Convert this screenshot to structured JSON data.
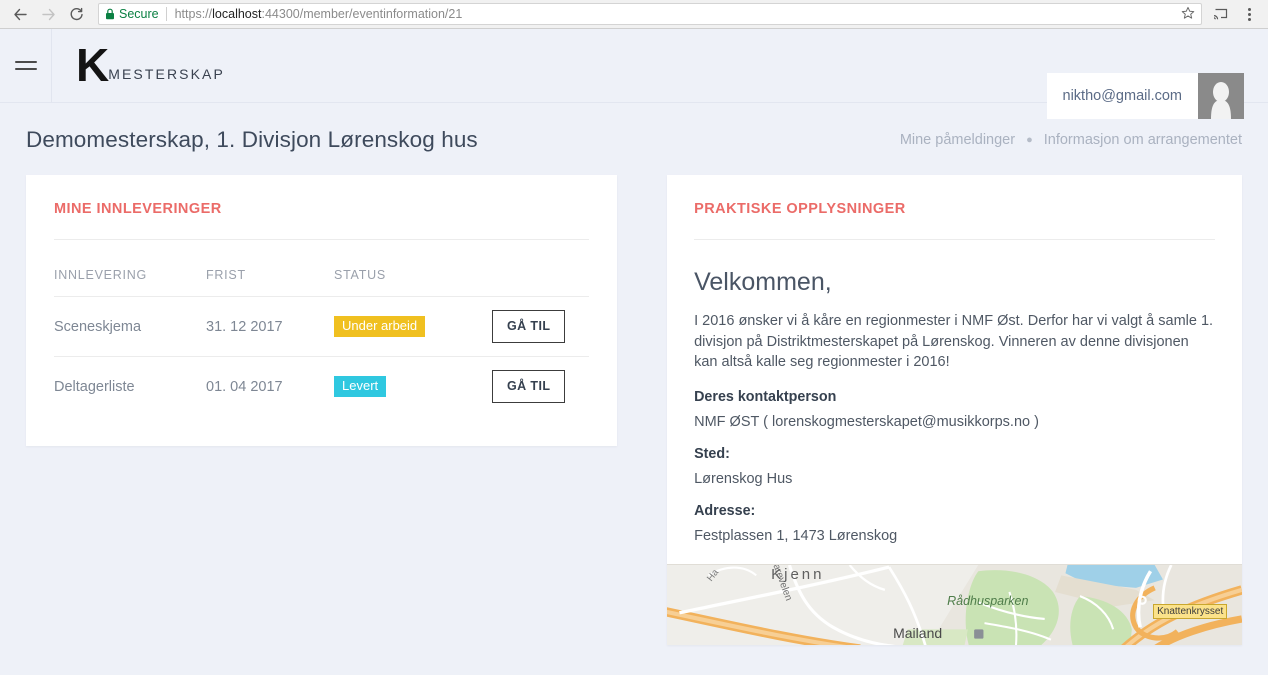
{
  "browser": {
    "back_icon": "back-arrow-icon",
    "forward_icon": "forward-arrow-icon",
    "reload_icon": "reload-icon",
    "secure_label": "Secure",
    "url_scheme": "https://",
    "url_host": "localhost",
    "url_path": ":44300/member/eventinformation/21",
    "url_full": "https://localhost:44300/member/eventinformation/21",
    "star_icon": "bookmark-star-icon",
    "cast_icon": "cast-icon",
    "menu_icon": "kebab-menu-icon"
  },
  "header": {
    "menu_icon": "hamburger-menu-icon",
    "logo_mark": "K",
    "logo_word": "MESTERSKAP",
    "user_email": "niktho@gmail.com",
    "avatar_icon": "user-avatar-icon"
  },
  "page": {
    "title": "Demomesterskap, 1. Divisjon Lørenskog hus",
    "breadcrumb": [
      {
        "label": "Mine påmeldinger"
      },
      {
        "label": "Informasjon om arrangementet"
      }
    ],
    "breadcrumb_separator": "●"
  },
  "submissions_card": {
    "heading": "MINE INNLEVERINGER",
    "columns": [
      "INNLEVERING",
      "FRIST",
      "STATUS",
      ""
    ],
    "rows": [
      {
        "name": "Sceneskjema",
        "deadline": "31. 12 2017",
        "status": "Under arbeid",
        "status_kind": "warn",
        "status_color": "#f0c020",
        "action": "GÅ TIL"
      },
      {
        "name": "Deltagerliste",
        "deadline": "01. 04 2017",
        "status": "Levert",
        "status_kind": "done",
        "status_color": "#2fc8e0",
        "action": "GÅ TIL"
      }
    ]
  },
  "info_card": {
    "heading": "PRAKTISKE OPPLYSNINGER",
    "welcome": "Velkommen,",
    "paragraph": "I 2016 ønsker vi å kåre en regionmester i NMF Øst. Derfor har vi valgt å samle 1. divisjon på Distriktmesterskapet på Lørenskog. Vinneren av denne divisjonen kan altså kalle seg regionmester i 2016!",
    "contact_label": "Deres kontaktperson",
    "contact_value": "NMF ØST ( lorenskogmesterskapet@musikkorps.no )",
    "place_label": "Sted:",
    "place_value": "Lørenskog Hus",
    "address_label": "Adresse:",
    "address_value": "Festplassen 1, 1473 Lørenskog"
  },
  "map": {
    "labels": {
      "district": "Kjenn",
      "park": "Rådhusparken",
      "place": "Mailand",
      "street_a": "Ha",
      "street_b": "arevelen",
      "junction": "Knattenkrysset"
    },
    "colors": {
      "land": "#e9e6df",
      "road": "#f2b25c",
      "water": "#9fd0e8",
      "park": "#c9e3b4"
    }
  },
  "theme": {
    "page_background": "#eef1f8",
    "accent": "#eb6b68",
    "card_background": "#ffffff",
    "title_color": "#3e4a5c"
  }
}
